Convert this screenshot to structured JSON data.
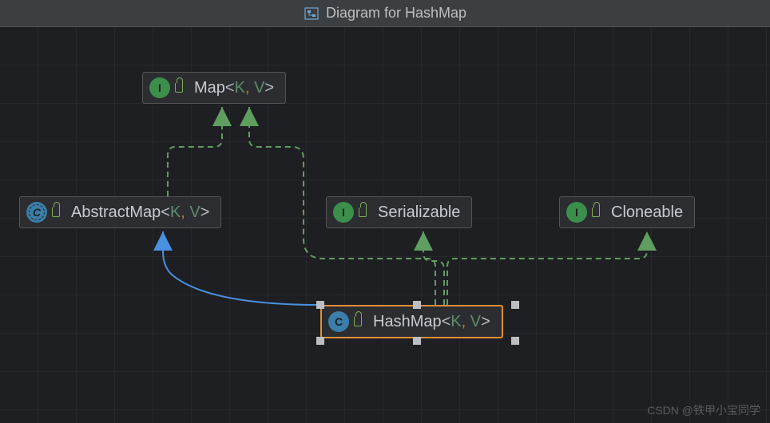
{
  "title": "Diagram for HashMap",
  "watermark": "CSDN @铁甲小宝同学",
  "nodes": {
    "map": {
      "name": "Map",
      "kind": "interface",
      "generics": [
        "K",
        "V"
      ]
    },
    "abstractMap": {
      "name": "AbstractMap",
      "kind": "abstract-class",
      "generics": [
        "K",
        "V"
      ]
    },
    "serializable": {
      "name": "Serializable",
      "kind": "interface",
      "generics": []
    },
    "cloneable": {
      "name": "Cloneable",
      "kind": "interface",
      "generics": []
    },
    "hashMap": {
      "name": "HashMap",
      "kind": "class",
      "generics": [
        "K",
        "V"
      ],
      "selected": true
    }
  },
  "edges": [
    {
      "from": "abstractMap",
      "to": "map",
      "type": "implements"
    },
    {
      "from": "hashMap",
      "to": "map",
      "type": "implements"
    },
    {
      "from": "hashMap",
      "to": "serializable",
      "type": "implements"
    },
    {
      "from": "hashMap",
      "to": "cloneable",
      "type": "implements"
    },
    {
      "from": "hashMap",
      "to": "abstractMap",
      "type": "extends"
    }
  ],
  "colors": {
    "extendsEdge": "#4a90e2",
    "implementsEdge": "#5f9e5f",
    "selection": "#e28f3a"
  }
}
